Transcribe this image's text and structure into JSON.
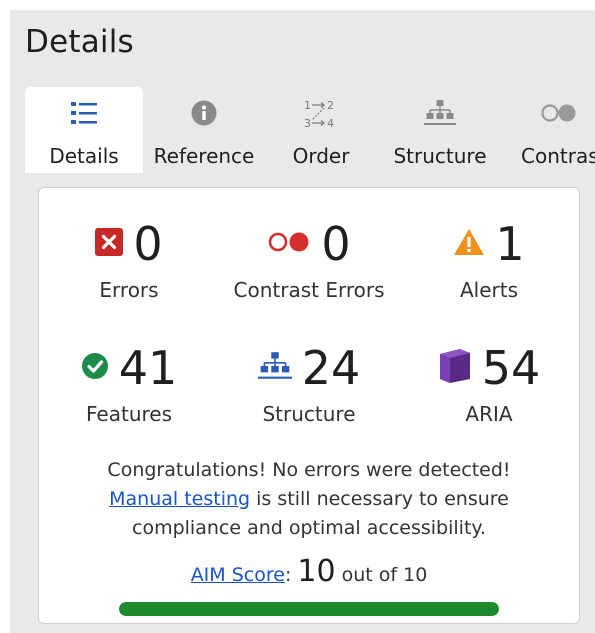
{
  "panel": {
    "title": "Details"
  },
  "tabs": [
    {
      "label": "Details",
      "icon": "list-icon",
      "active": true
    },
    {
      "label": "Reference",
      "icon": "info-icon",
      "active": false
    },
    {
      "label": "Order",
      "icon": "order-arrows-icon",
      "active": false
    },
    {
      "label": "Structure",
      "icon": "hierarchy-icon",
      "active": false
    },
    {
      "label": "Contrast",
      "icon": "contrast-circles-icon",
      "active": false
    }
  ],
  "summary": {
    "errors": {
      "count": "0",
      "label": "Errors",
      "icon": "error-x-icon",
      "color": "#c62828"
    },
    "contrast_errors": {
      "count": "0",
      "label": "Contrast Errors",
      "icon": "contrast-circles-icon",
      "color": "#d32f2f"
    },
    "alerts": {
      "count": "1",
      "label": "Alerts",
      "icon": "warning-triangle-icon",
      "color": "#f0911e"
    },
    "features": {
      "count": "41",
      "label": "Features",
      "icon": "check-circle-icon",
      "color": "#1e8a4a"
    },
    "structure": {
      "count": "24",
      "label": "Structure",
      "icon": "hierarchy-icon",
      "color": "#2b5bb8"
    },
    "aria": {
      "count": "54",
      "label": "ARIA",
      "icon": "aria-cube-icon",
      "color": "#5b2a86"
    }
  },
  "message": {
    "line1": "Congratulations! No errors were detected!",
    "link_text": "Manual testing",
    "line2_rest": " is still necessary to ensure",
    "line3": "compliance and optimal accessibility."
  },
  "score": {
    "link_text": "AIM Score",
    "colon": ":",
    "value": "10",
    "suffix": "out of 10",
    "fraction": 1.0,
    "bar_color": "#1e8a2e"
  }
}
